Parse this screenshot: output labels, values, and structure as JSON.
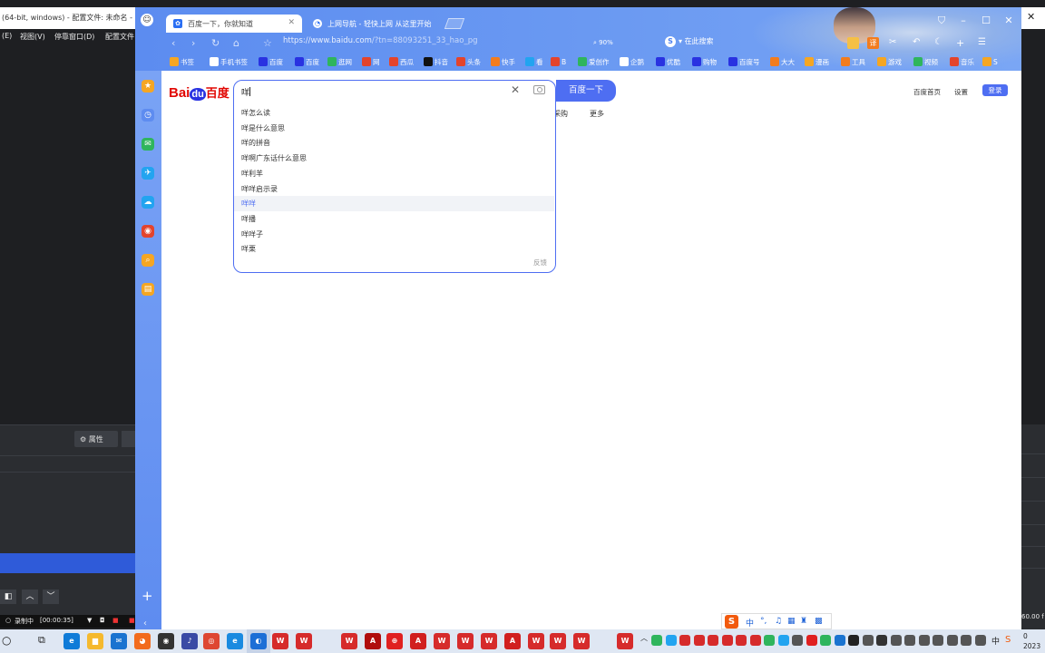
{
  "obs": {
    "title": "(64-bit, windows) - 配置文件: 未命名 -",
    "menu": [
      "(E)",
      "视图(V)",
      "停靠窗口(D)",
      "配置文件"
    ],
    "properties_label": "属性",
    "recording_label": "录制中",
    "recording_time": "[00:00:35]",
    "fps": "60.00 f"
  },
  "browser": {
    "tabs": [
      {
        "label": "百度一下，你就知道",
        "active": true
      },
      {
        "label": "上网导航 - 轻快上网 从这里开始",
        "active": false
      }
    ],
    "url_host": "https://www.baidu.com",
    "url_path": "/?tn=88093251_33_hao_pg",
    "zoom": "90%",
    "side_search_label": "在此搜索",
    "translate_badge": "译",
    "bookmarks": [
      {
        "label": "书签",
        "color": "#f5a623"
      },
      {
        "label": "手机书签",
        "color": "#ffffff"
      },
      {
        "label": "百度",
        "color": "#2932e1"
      },
      {
        "label": "百度",
        "color": "#2932e1"
      },
      {
        "label": "逛网",
        "color": "#2fb55d"
      },
      {
        "label": "网",
        "color": "#e3442c"
      },
      {
        "label": "西瓜",
        "color": "#e3442c"
      },
      {
        "label": "抖音",
        "color": "#111111"
      },
      {
        "label": "头条",
        "color": "#e3442c"
      },
      {
        "label": "快手",
        "color": "#f27c1e"
      },
      {
        "label": "看",
        "color": "#22a4f0"
      },
      {
        "label": "B",
        "color": "#e3442c"
      },
      {
        "label": "爱创作",
        "color": "#2fb55d"
      },
      {
        "label": "企鹅",
        "color": "#ffffff"
      },
      {
        "label": "优酷",
        "color": "#2932e1"
      },
      {
        "label": "购物",
        "color": "#2932e1"
      },
      {
        "label": "百度号",
        "color": "#2932e1"
      },
      {
        "label": "大大",
        "color": "#f27c1e"
      },
      {
        "label": "漫画",
        "color": "#f5a623"
      },
      {
        "label": "工具",
        "color": "#f27c1e"
      },
      {
        "label": "游戏",
        "color": "#f5a623"
      },
      {
        "label": "视频",
        "color": "#2fb55d"
      },
      {
        "label": "音乐",
        "color": "#e3442c"
      },
      {
        "label": "S",
        "color": "#f5a623"
      }
    ],
    "sidebar_icons": [
      {
        "name": "star-icon",
        "color": "#f5a623",
        "glyph": "★"
      },
      {
        "name": "history-clock-icon",
        "color": "#5e8cf0",
        "glyph": "◷"
      },
      {
        "name": "wechat-icon",
        "color": "#2fb55d",
        "glyph": "✉"
      },
      {
        "name": "plane-icon",
        "color": "#22a4f0",
        "glyph": "✈"
      },
      {
        "name": "cloud-icon",
        "color": "#22a4f0",
        "glyph": "☁"
      },
      {
        "name": "weibo-icon",
        "color": "#e3442c",
        "glyph": "◉"
      },
      {
        "name": "search-icon",
        "color": "#f5a623",
        "glyph": "⌕"
      },
      {
        "name": "note-icon",
        "color": "#f5a623",
        "glyph": "▤"
      }
    ]
  },
  "baidu": {
    "logo_bai": "Bai",
    "logo_du": "du",
    "logo_cn": "百度",
    "query": "咩",
    "search_button": "百度一下",
    "suggestions": [
      "咩怎么读",
      "咩是什么意思",
      "咩的拼音",
      "咩啊广东话什么意思",
      "咩利羊",
      "咩咩启示录",
      "咩咩",
      "咩播",
      "咩咩子",
      "咩栗"
    ],
    "highlighted_index": 6,
    "feedback": "反馈",
    "behind_links": [
      "采购",
      "更多"
    ],
    "top_links": [
      "百度首页",
      "设置"
    ],
    "login": "登录"
  },
  "ime": {
    "logo": "S",
    "mode": "中",
    "punct": "°,"
  },
  "taskbar": {
    "language": "中",
    "time": "0",
    "year": "2023",
    "apps": [
      {
        "name": "edge-icon",
        "color": "#0f7bd8",
        "glyph": "e"
      },
      {
        "name": "file-explorer-icon",
        "color": "#f5b92e",
        "glyph": "▆"
      },
      {
        "name": "mail-icon",
        "color": "#1a73d0",
        "glyph": "✉"
      },
      {
        "name": "firefox-icon",
        "color": "#f26b1d",
        "glyph": "◕"
      },
      {
        "name": "obs-icon",
        "color": "#333333",
        "glyph": "◉"
      },
      {
        "name": "app-icon",
        "color": "#3a4aa5",
        "glyph": "♪"
      },
      {
        "name": "chrome-icon",
        "color": "#de4632",
        "glyph": "◎"
      },
      {
        "name": "ie-icon",
        "color": "#1a8ae0",
        "glyph": "e"
      },
      {
        "name": "browser-360-icon",
        "color": "#1d6fd6",
        "glyph": "◐"
      },
      {
        "name": "wps-icon",
        "color": "#d62b2b",
        "glyph": "W"
      },
      {
        "name": "wps-icon",
        "color": "#d62b2b",
        "glyph": "W"
      },
      {
        "name": "wps-icon",
        "color": "#d62b2b",
        "glyph": "W"
      },
      {
        "name": "adobe-icon",
        "color": "#b00d0d",
        "glyph": "A"
      },
      {
        "name": "target-icon",
        "color": "#e02020",
        "glyph": "⊕"
      },
      {
        "name": "acrobat-icon",
        "color": "#d11f1f",
        "glyph": "A"
      },
      {
        "name": "wps-icon",
        "color": "#d62b2b",
        "glyph": "W"
      },
      {
        "name": "wps-icon",
        "color": "#d62b2b",
        "glyph": "W"
      },
      {
        "name": "wps-icon",
        "color": "#d62b2b",
        "glyph": "W"
      },
      {
        "name": "acrobat-icon",
        "color": "#d11f1f",
        "glyph": "A"
      },
      {
        "name": "wps-icon",
        "color": "#d62b2b",
        "glyph": "W"
      },
      {
        "name": "wps-icon",
        "color": "#d62b2b",
        "glyph": "W"
      },
      {
        "name": "wps-icon",
        "color": "#d62b2b",
        "glyph": "W"
      },
      {
        "name": "wps-icon",
        "color": "#d62b2b",
        "glyph": "W"
      }
    ]
  }
}
